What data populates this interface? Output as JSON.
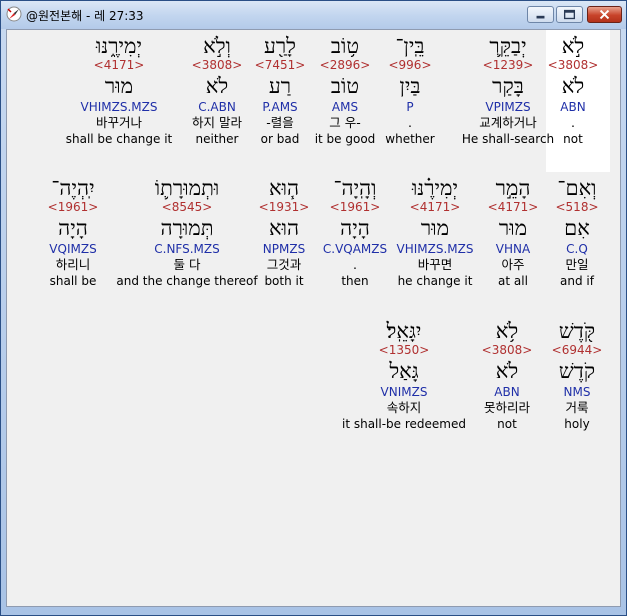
{
  "window": {
    "title": "@원전본해 - 레 27:33",
    "app_icon": "compass-app-icon",
    "controls": [
      "minimize-icon",
      "maximize-icon",
      "close-icon"
    ]
  },
  "colors": {
    "strong": "#b03030",
    "morph": "#1f2fa8",
    "highlight": "#ffffff"
  },
  "words": [
    {
      "heb": "לֹ֣א",
      "strong": "<3808>",
      "lemma": "לֹא",
      "morph": "ABN",
      "kor": ".",
      "eng": "not",
      "highlighted": true
    },
    {
      "heb": "יְבַקֵּ֛ר",
      "strong": "<1239>",
      "lemma": "בָּקַר",
      "morph": "VPIMZS",
      "kor": "교계하거나",
      "eng": "He shall-search"
    },
    {
      "heb": "בֵּֽין־",
      "strong": "<996>",
      "lemma": "בַּיִן",
      "morph": "P",
      "kor": ".",
      "eng": "whether"
    },
    {
      "heb": "ט֥וֹב",
      "strong": "<2896>",
      "lemma": "טוֹב",
      "morph": "AMS",
      "kor": "그 우-",
      "eng": "it be good"
    },
    {
      "heb": "לָרַ֖ע",
      "strong": "<7451>",
      "lemma": "רַע",
      "morph": "P.AMS",
      "kor": "-렬을",
      "eng": "or bad"
    },
    {
      "heb": "וְלֹ֣א",
      "strong": "<3808>",
      "lemma": "לֹא",
      "morph": "C.ABN",
      "kor": "하지 말라",
      "eng": "neither"
    },
    {
      "heb": "יְמִירֶ֑נּוּ",
      "strong": "<4171>",
      "lemma": "מוּר",
      "morph": "VHIMZS.MZS",
      "kor": "바꾸거나",
      "eng": "shall be change it"
    },
    {
      "heb": "וְאִם־",
      "strong": "<518>",
      "lemma": "אִם",
      "morph": "C.Q",
      "kor": "만일",
      "eng": "and if"
    },
    {
      "heb": "הָמֵ֣ר",
      "strong": "<4171>",
      "lemma": "מוּר",
      "morph": "VHNA",
      "kor": "아주",
      "eng": "at all"
    },
    {
      "heb": "יְמִירֶ֗נּוּ",
      "strong": "<4171>",
      "lemma": "מוּר",
      "morph": "VHIMZS.MZS",
      "kor": "바꾸면",
      "eng": "he change it"
    },
    {
      "heb": "וְהָֽיָה־",
      "strong": "<1961>",
      "lemma": "הָיָה",
      "morph": "C.VQAMZS",
      "kor": ".",
      "eng": "then"
    },
    {
      "heb": "ה֧וּא",
      "strong": "<1931>",
      "lemma": "הוּא",
      "morph": "NPMZS",
      "kor": "그것과",
      "eng": "both it"
    },
    {
      "heb": "וּתְמוּרָת֛וֹ",
      "strong": "<8545>",
      "lemma": "תְּמוּרָה",
      "morph": "C.NFS.MZS",
      "kor": "둘 다",
      "eng": "and the change thereof"
    },
    {
      "heb": "יִֽהְיֶה־",
      "strong": "<1961>",
      "lemma": "הָיָה",
      "morph": "VQIMZS",
      "kor": "하리니",
      "eng": "shall be"
    },
    {
      "heb": "קֹּ֖דֶשׁ",
      "strong": "<6944>",
      "lemma": "קֹדֶשׁ",
      "morph": "NMS",
      "kor": "거룩",
      "eng": "holy"
    },
    {
      "heb": "לֹ֥א",
      "strong": "<3808>",
      "lemma": "לֹא",
      "morph": "ABN",
      "kor": "못하리라",
      "eng": "not"
    },
    {
      "heb": "יִגָּאֵֽל׃",
      "strong": "<1350>",
      "lemma": "גָּאַל",
      "morph": "VNIMZS",
      "kor": "속하지",
      "eng": "it shall-be redeemed"
    }
  ]
}
